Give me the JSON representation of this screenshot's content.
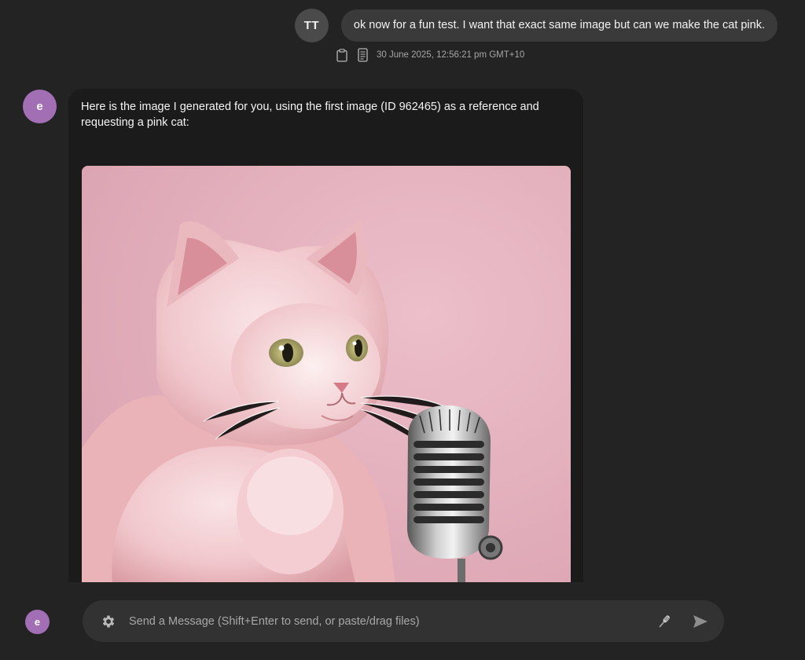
{
  "user_message": {
    "avatar_initials": "TT",
    "text": "ok now for a fun test. I want that exact same image but can we make the cat pink.",
    "timestamp": "30 June 2025, 12:56:21 pm GMT+10",
    "icons": [
      "clipboard-icon",
      "document-info-icon"
    ]
  },
  "assistant_message": {
    "avatar_initial": "e",
    "avatar_color": "#a36fb4",
    "text": "Here is the image I generated for you, using the first image (ID 962465) as a reference and requesting a pink cat:",
    "image_description_icon": "generated-image",
    "image_background_color": "#e2aebb"
  },
  "composer": {
    "avatar_initial": "e",
    "placeholder": "Send a Message (Shift+Enter to send, or paste/drag files)",
    "value": "",
    "icons": [
      "gear-icon",
      "microphone-icon",
      "send-icon"
    ]
  },
  "colors": {
    "background": "#232323",
    "user_bubble": "#3a3a3a",
    "assistant_card": "#1b1b1b",
    "input_bar": "#323232"
  }
}
